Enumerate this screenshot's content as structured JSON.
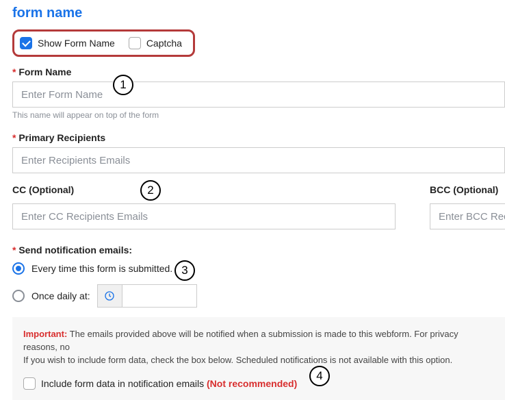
{
  "title": "form name",
  "options": {
    "show_form_name": "Show Form Name",
    "captcha": "Captcha"
  },
  "formName": {
    "label": "Form Name",
    "placeholder": "Enter Form Name",
    "help": "This name will appear on top of the form"
  },
  "primary": {
    "label": "Primary Recipients",
    "placeholder": "Enter Recipients Emails"
  },
  "cc": {
    "label": "CC (Optional)",
    "placeholder": "Enter CC Recipients Emails"
  },
  "bcc": {
    "label": "BCC (Optional)",
    "placeholder": "Enter BCC Recip"
  },
  "notify": {
    "label": "Send notification emails:",
    "opt_every": "Every time this form is submitted.",
    "opt_daily": "Once daily at:"
  },
  "info": {
    "important": "Important:",
    "line1": " The emails provided above will be notified when a submission is made to this webform. For privacy reasons, no",
    "line2": "If you wish to include form data, check the box below. Scheduled notifications is not available with this option.",
    "include_pre": "Include form data in notification emails ",
    "include_warn": "(Not recommended)"
  },
  "markers": {
    "m1": "1",
    "m2": "2",
    "m3": "3",
    "m4": "4"
  }
}
